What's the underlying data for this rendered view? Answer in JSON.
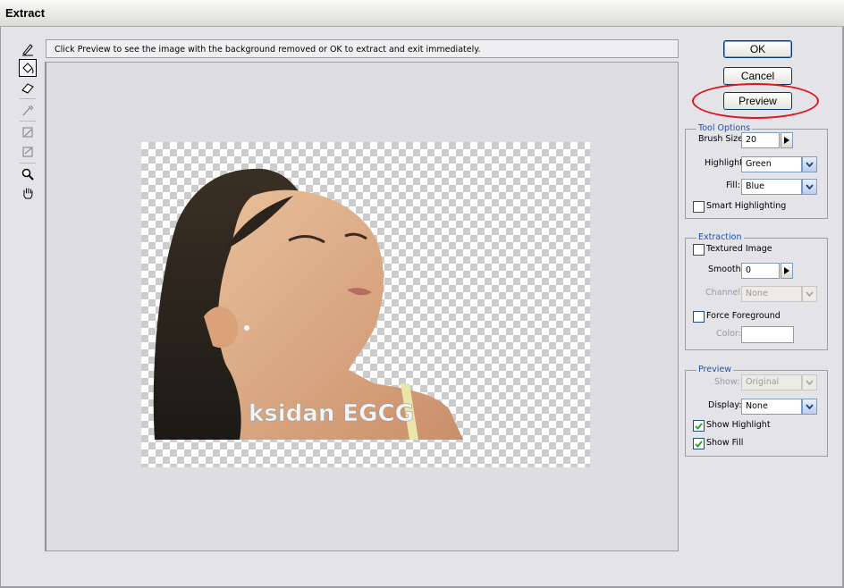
{
  "window": {
    "title": "Extract"
  },
  "hint_text": "Click Preview to see the image with the background removed or OK to extract and exit immediately.",
  "tools": [
    {
      "name": "edge-highlighter-tool",
      "icon": "highlighter-icon"
    },
    {
      "name": "fill-tool",
      "icon": "paint-bucket-icon",
      "active": true
    },
    {
      "name": "eraser-tool",
      "icon": "eraser-icon"
    },
    {
      "name": "eyedropper-tool",
      "icon": "eyedropper-icon",
      "disabled": true
    },
    {
      "name": "cleanup-tool",
      "icon": "cleanup-icon",
      "disabled": true
    },
    {
      "name": "edge-touchup-tool",
      "icon": "edge-touchup-icon",
      "disabled": true
    },
    {
      "name": "zoom-tool",
      "icon": "magnifier-icon"
    },
    {
      "name": "hand-tool",
      "icon": "hand-icon"
    }
  ],
  "canvas": {
    "watermark": "ksidan EGCG"
  },
  "buttons": {
    "ok": "OK",
    "cancel": "Cancel",
    "preview": "Preview"
  },
  "tool_options": {
    "title": "Tool Options",
    "brush_size_label": "Brush Size:",
    "brush_size_value": "20",
    "highlight_label": "Highlight:",
    "highlight_value": "Green",
    "fill_label": "Fill:",
    "fill_value": "Blue",
    "smart_highlighting_label": "Smart Highlighting",
    "smart_highlighting_checked": false
  },
  "extraction": {
    "title": "Extraction",
    "textured_image_label": "Textured Image",
    "textured_image_checked": false,
    "smooth_label": "Smooth:",
    "smooth_value": "0",
    "channel_label": "Channel:",
    "channel_value": "None",
    "force_foreground_label": "Force Foreground",
    "force_foreground_checked": false,
    "color_label": "Color:",
    "color_value": ""
  },
  "preview": {
    "title": "Preview",
    "show_label": "Show:",
    "show_value": "Original",
    "display_label": "Display:",
    "display_value": "None",
    "show_highlight_label": "Show Highlight",
    "show_highlight_checked": true,
    "show_fill_label": "Show Fill",
    "show_fill_checked": true
  },
  "colors": {
    "accent": "#1f4fb4",
    "annotation": "#e0141e",
    "button_border": "#003c74"
  }
}
